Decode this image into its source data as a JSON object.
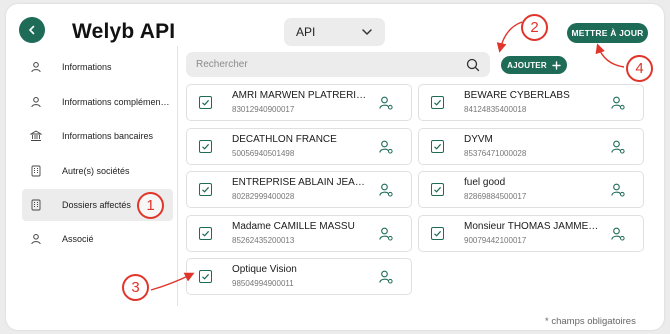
{
  "header": {
    "title": "Welyb API",
    "api_select_value": "API",
    "update_label": "METTRE À JOUR"
  },
  "sidebar": {
    "items": [
      {
        "label": "Informations",
        "icon": "user-icon"
      },
      {
        "label": "Informations complémentaires",
        "icon": "user-icon"
      },
      {
        "label": "Informations bancaires",
        "icon": "bank-icon"
      },
      {
        "label": "Autre(s) sociétés",
        "icon": "building-icon"
      },
      {
        "label": "Dossiers affectés",
        "icon": "building-icon",
        "active": true
      },
      {
        "label": "Associé",
        "icon": "user-icon"
      }
    ]
  },
  "search": {
    "placeholder": "Rechercher"
  },
  "add_label": "AJOUTER",
  "companies": [
    {
      "name": "AMRI MARWEN PLATRERIE SAS",
      "siret": "83012940900017"
    },
    {
      "name": "BEWARE CYBERLABS",
      "siret": "84124835400018"
    },
    {
      "name": "DECATHLON FRANCE",
      "siret": "50056940501498"
    },
    {
      "name": "DYVM",
      "siret": "85376471000028"
    },
    {
      "name": "ENTREPRISE ABLAIN JEAN-MARC",
      "siret": "80282999400028"
    },
    {
      "name": "fuel good",
      "siret": "82869884500017"
    },
    {
      "name": "Madame CAMILLE MASSU",
      "siret": "85262435200013"
    },
    {
      "name": "Monsieur THOMAS JAMME DESIGN",
      "siret": "90079442100017"
    },
    {
      "name": "Optique Vision",
      "siret": "98504994900011"
    }
  ],
  "footnote": "* champs obligatoires",
  "markers": [
    "1",
    "2",
    "3",
    "4"
  ],
  "colors": {
    "brand": "#1e6b57",
    "marker": "#e0352b"
  }
}
